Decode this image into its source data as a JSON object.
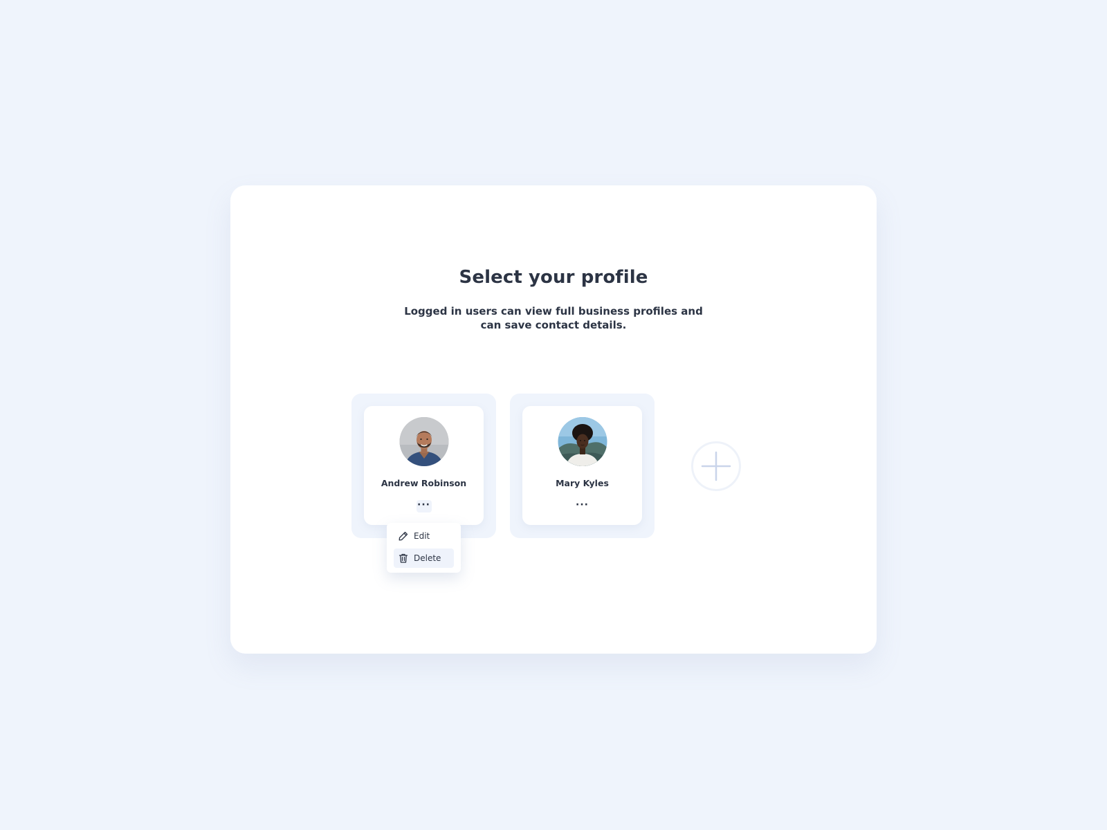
{
  "page": {
    "title": "Select your profile",
    "subtitle": "Logged in users can view full business profiles and can save contact details."
  },
  "profiles": [
    {
      "name": "Andrew Robinson",
      "avatar_icon": "user-photo-icon",
      "menu_open": true
    },
    {
      "name": "Mary Kyles",
      "avatar_icon": "user-photo-icon",
      "menu_open": false
    }
  ],
  "more_button": {
    "label": "···",
    "icon": "more-horizontal-icon"
  },
  "context_menu": {
    "items": [
      {
        "label": "Edit",
        "icon": "pencil-icon",
        "highlighted": false
      },
      {
        "label": "Delete",
        "icon": "trash-icon",
        "highlighted": true
      }
    ]
  },
  "add_button": {
    "icon": "plus-icon"
  },
  "colors": {
    "background": "#eff4fc",
    "panel": "#ffffff",
    "text": "#2c3444",
    "plus_icon": "#c9d4ea"
  }
}
